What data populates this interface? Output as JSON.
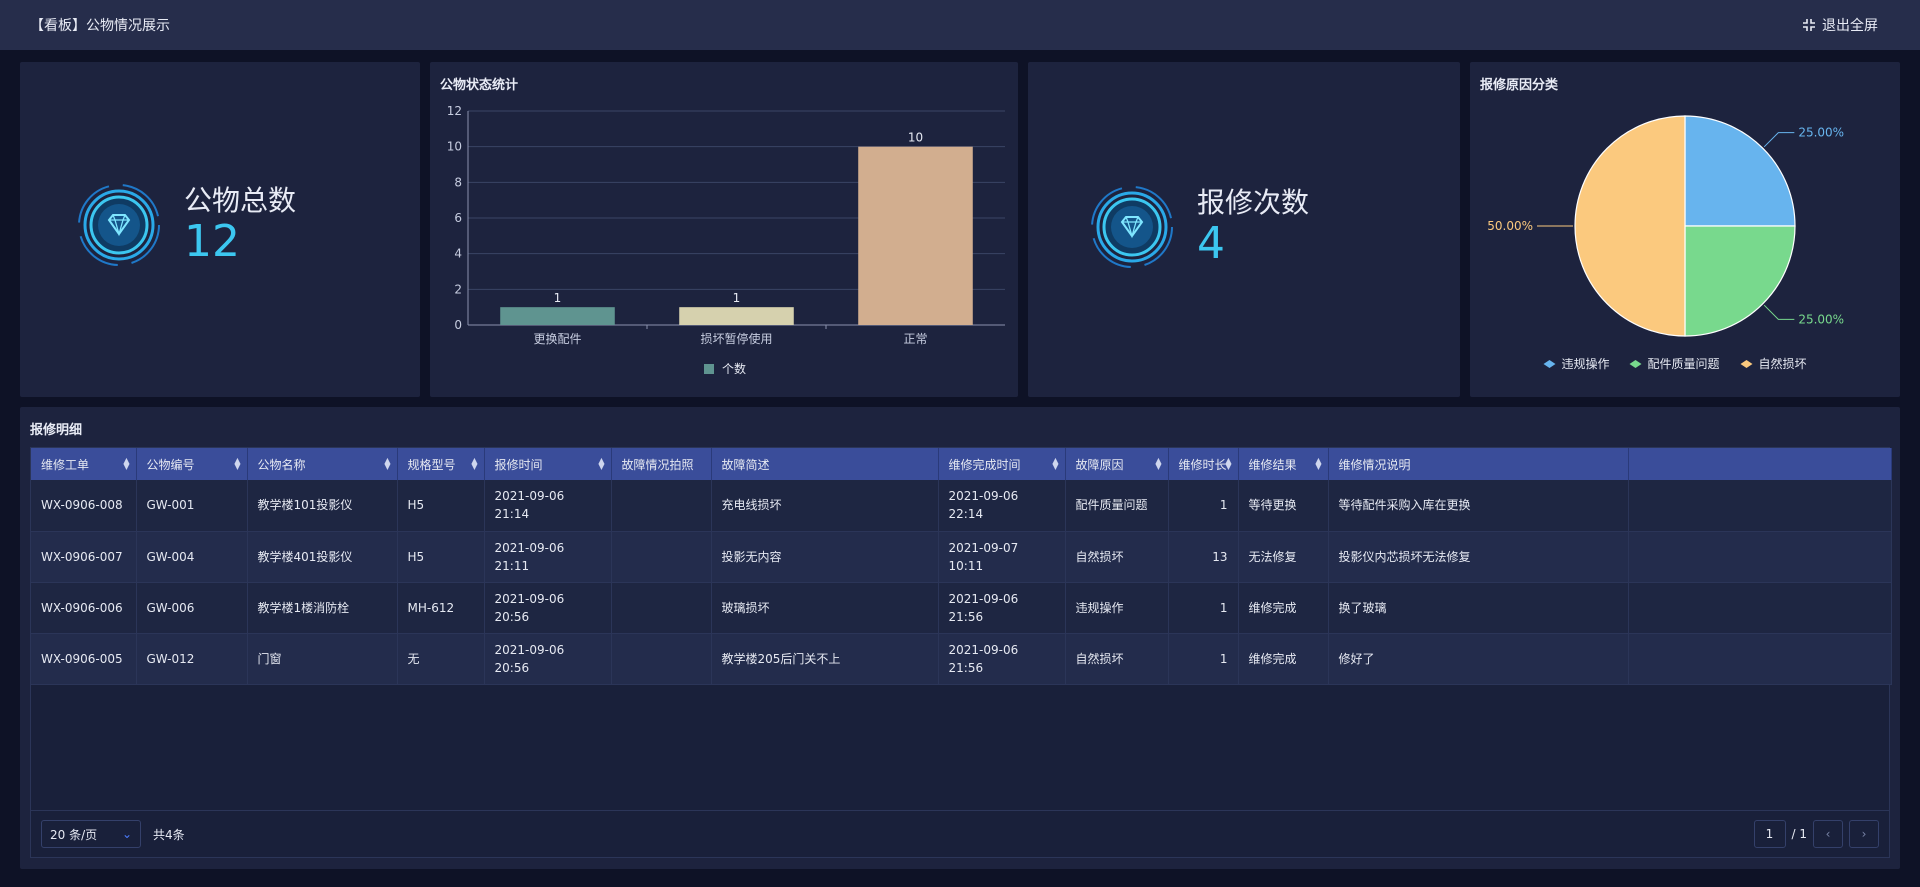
{
  "header": {
    "title": "【看板】公物情况展示",
    "exit_label": "退出全屏"
  },
  "stats": {
    "total_label": "公物总数",
    "total_value": "12",
    "repair_label": "报修次数",
    "repair_value": "4"
  },
  "bar_card": {
    "title": "公物状态统计",
    "chart_data": {
      "type": "bar",
      "categories": [
        "更换配件",
        "损坏暂停使用",
        "正常"
      ],
      "series": [
        {
          "name": "个数",
          "values": [
            1,
            1,
            10
          ]
        }
      ],
      "ylim": [
        0,
        12
      ],
      "yticks": [
        0,
        2,
        4,
        6,
        8,
        10,
        12
      ],
      "colors": [
        "#5f9490",
        "#d6d1ae",
        "#d2ae8f"
      ],
      "legend_color": "#5f9490",
      "legend_position": "bottom"
    }
  },
  "pie_card": {
    "title": "报修原因分类",
    "chart_data": {
      "type": "pie",
      "slices": [
        {
          "name": "违规操作",
          "value": 25.0,
          "label": "25.00%",
          "color": "#67b4ee"
        },
        {
          "name": "配件质量问题",
          "value": 25.0,
          "label": "25.00%",
          "color": "#78d98d"
        },
        {
          "name": "自然损坏",
          "value": 50.0,
          "label": "50.00%",
          "color": "#fbc97e"
        }
      ],
      "legend_position": "bottom"
    }
  },
  "table": {
    "title": "报修明细",
    "columns": [
      "维修工单",
      "公物编号",
      "公物名称",
      "规格型号",
      "报修时间",
      "故障情况拍照",
      "故障简述",
      "维修完成时间",
      "故障原因",
      "维修时长",
      "维修结果",
      "维修情况说明",
      ""
    ],
    "sortable": [
      true,
      true,
      true,
      true,
      true,
      false,
      false,
      true,
      true,
      true,
      true,
      false,
      false
    ],
    "rows": [
      [
        "WX-0906-008",
        "GW-001",
        "教学楼101投影仪",
        "H5",
        "2021-09-06 21:14",
        "",
        "充电线损坏",
        "2021-09-06 22:14",
        "配件质量问题",
        "1",
        "等待更换",
        "等待配件采购入库在更换",
        ""
      ],
      [
        "WX-0906-007",
        "GW-004",
        "教学楼401投影仪",
        "H5",
        "2021-09-06 21:11",
        "",
        "投影无内容",
        "2021-09-07 10:11",
        "自然损坏",
        "13",
        "无法修复",
        "投影仪内芯损坏无法修复",
        ""
      ],
      [
        "WX-0906-006",
        "GW-006",
        "教学楼1楼消防栓",
        "MH-612",
        "2021-09-06 20:56",
        "",
        "玻璃损坏",
        "2021-09-06 21:56",
        "违规操作",
        "1",
        "维修完成",
        "换了玻璃",
        ""
      ],
      [
        "WX-0906-005",
        "GW-012",
        "门窗",
        "无",
        "2021-09-06 20:56",
        "",
        "教学楼205后门关不上",
        "2021-09-06 21:56",
        "自然损坏",
        "1",
        "维修完成",
        "修好了",
        ""
      ]
    ]
  },
  "pager": {
    "page_size": "20 条/页",
    "total": "共4条",
    "current": "1",
    "of_total": "/ 1"
  }
}
